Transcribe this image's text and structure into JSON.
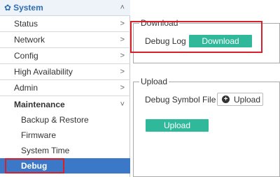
{
  "sidebar": {
    "header": {
      "label": "System",
      "icon": "gear-icon",
      "chevron": "˄"
    },
    "items": [
      {
        "label": "Status",
        "chevron": ">"
      },
      {
        "label": "Network",
        "chevron": ">"
      },
      {
        "label": "Config",
        "chevron": ">"
      },
      {
        "label": "High Availability",
        "chevron": ">"
      },
      {
        "label": "Admin",
        "chevron": ">"
      },
      {
        "label": "Maintenance",
        "chevron": "˅"
      }
    ],
    "maintenance_sub": [
      {
        "label": "Backup & Restore"
      },
      {
        "label": "Firmware"
      },
      {
        "label": "System Time"
      },
      {
        "label": "Debug"
      }
    ]
  },
  "download_section": {
    "legend": "Download",
    "debug_log_label": "Debug Log",
    "download_button": "Download"
  },
  "upload_section": {
    "legend": "Upload",
    "debug_symbol_label": "Debug Symbol File",
    "choose_button": "Upload",
    "upload_button": "Upload"
  },
  "colors": {
    "accent": "#2e6db4",
    "active_bg": "#3b79c8",
    "button_green": "#2fb99a",
    "highlight_red": "#d9202a"
  }
}
